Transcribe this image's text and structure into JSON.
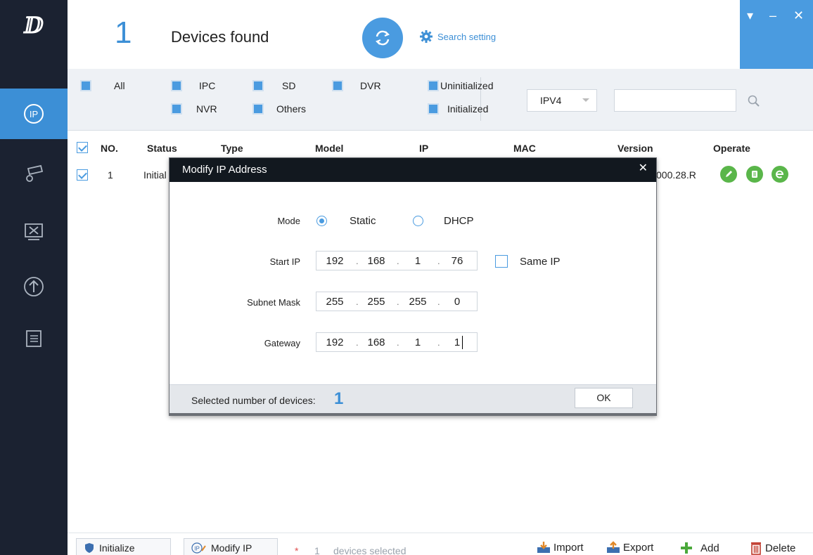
{
  "header": {
    "found_count": "1",
    "found_label": "Devices found",
    "search_setting_label": "Search setting"
  },
  "filters": {
    "all": "All",
    "ipc": "IPC",
    "sd": "SD",
    "dvr": "DVR",
    "nvr": "NVR",
    "others": "Others",
    "uninitialized": "Uninitialized",
    "initialized": "Initialized",
    "ip_version": "IPV4"
  },
  "table": {
    "columns": [
      "NO.",
      "Status",
      "Type",
      "Model",
      "IP",
      "MAC",
      "Version",
      "Operate"
    ],
    "rows": [
      {
        "no": "1",
        "status": "Initial",
        "version": "000.28.R"
      }
    ]
  },
  "modal": {
    "title": "Modify IP Address",
    "mode_label": "Mode",
    "mode_static": "Static",
    "mode_dhcp": "DHCP",
    "start_ip_label": "Start IP",
    "start_ip": [
      "192",
      "168",
      "1",
      "76"
    ],
    "same_ip_label": "Same IP",
    "subnet_label": "Subnet Mask",
    "subnet": [
      "255",
      "255",
      "255",
      "0"
    ],
    "gateway_label": "Gateway",
    "gateway": [
      "192",
      "168",
      "1",
      "1"
    ],
    "selected_label": "Selected number of devices:",
    "selected_count": "1",
    "ok_label": "OK"
  },
  "bottom": {
    "initialize_label": "Initialize",
    "modify_ip_label": "Modify IP",
    "selected_star": "*",
    "selected_count": "1",
    "selected_text": "devices selected",
    "import_label": "Import",
    "export_label": "Export",
    "add_label": "Add",
    "delete_label": "Delete"
  },
  "colors": {
    "accent": "#4a9be0",
    "sidebar": "#1b2231",
    "operate_green": "#5ab64a",
    "delete_red": "#c0392b"
  }
}
